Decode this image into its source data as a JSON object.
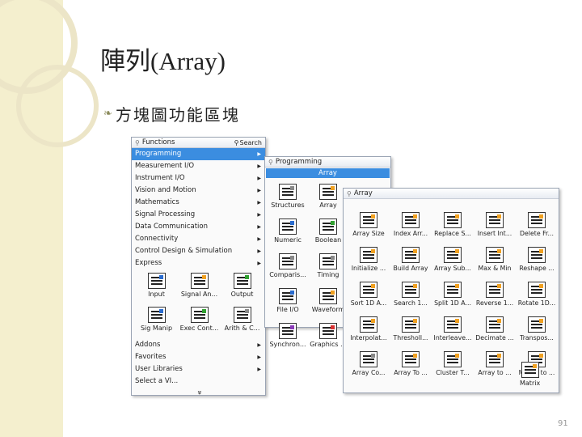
{
  "slide": {
    "title": "陣列(Array)",
    "bullet": "方塊圖功能區塊",
    "page_number": "91",
    "colors": {
      "band": "#f4efce",
      "selection": "#3b8de0"
    }
  },
  "functions_palette": {
    "title": "Functions",
    "search_label": "Search",
    "pin_icon": "pushpin-icon",
    "search_icon": "magnifier-icon",
    "categories": [
      {
        "label": "Programming",
        "selected": true
      },
      {
        "label": "Measurement I/O"
      },
      {
        "label": "Instrument I/O"
      },
      {
        "label": "Vision and Motion"
      },
      {
        "label": "Mathematics"
      },
      {
        "label": "Signal Processing"
      },
      {
        "label": "Data Communication"
      },
      {
        "label": "Connectivity"
      },
      {
        "label": "Control Design & Simulation"
      },
      {
        "label": "Express"
      }
    ],
    "express_icons": [
      "Input",
      "Signal An...",
      "Output",
      "Sig Manip",
      "Exec Cont...",
      "Arith & C..."
    ],
    "bottom_items": [
      {
        "label": "Addons"
      },
      {
        "label": "Favorites"
      },
      {
        "label": "User Libraries"
      },
      {
        "label": "Select a VI..."
      }
    ],
    "more_indicator": "»"
  },
  "programming_palette": {
    "title": "Programming",
    "selected_item": "Array",
    "items": [
      "Structures",
      "Array",
      "Numeric",
      "Boolean",
      "Comparis...",
      "Timing",
      "File I/O",
      "Waveform",
      "Synchron...",
      "Graphics ..."
    ]
  },
  "array_palette": {
    "title": "Array",
    "items": [
      "Array Size",
      "Index Arr...",
      "Replace S...",
      "Insert Int...",
      "Delete Fr...",
      "Initialize ...",
      "Build Array",
      "Array Sub...",
      "Max & Min",
      "Reshape ...",
      "Sort 1D A...",
      "Search 1...",
      "Split 1D A...",
      "Reverse 1...",
      "Rotate 1D...",
      "Interpolat...",
      "Thresholl...",
      "Interleave...",
      "Decimate ...",
      "Transpos...",
      "Array Co...",
      "Array To ...",
      "Cluster T...",
      "Array to ...",
      "Matrix to ..."
    ],
    "last_item": "Matrix"
  }
}
